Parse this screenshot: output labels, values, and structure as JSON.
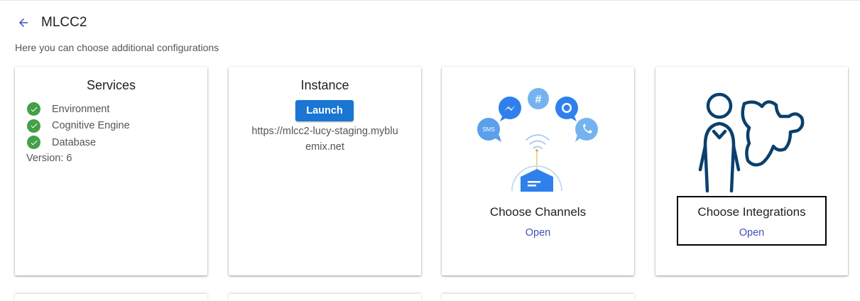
{
  "header": {
    "title": "MLCC2",
    "back_icon": "arrow-left-icon"
  },
  "subtitle": "Here you can choose additional configurations",
  "colors": {
    "accent": "#1976d2",
    "link": "#3f51b5",
    "check": "#43a047",
    "illustration": "#4a90e2",
    "navy": "#0b3f6d"
  },
  "services": {
    "title": "Services",
    "items": [
      {
        "label": "Environment",
        "status_icon": "check-circle-icon"
      },
      {
        "label": "Cognitive Engine",
        "status_icon": "check-circle-icon"
      },
      {
        "label": "Database",
        "status_icon": "check-circle-icon"
      }
    ],
    "version_label": "Version:",
    "version_value": "6"
  },
  "instance": {
    "title": "Instance",
    "launch_label": "Launch",
    "url": "https://mlcc2-lucy-staging.mybluemix.net"
  },
  "channels": {
    "label": "Choose Channels",
    "open_label": "Open",
    "bubbles": [
      {
        "icon": "sms-icon",
        "text": "SMS"
      },
      {
        "icon": "messenger-icon"
      },
      {
        "icon": "hashtag-icon",
        "text": "#"
      },
      {
        "icon": "chat-icon"
      },
      {
        "icon": "phone-icon"
      }
    ]
  },
  "integrations": {
    "label": "Choose Integrations",
    "open_label": "Open",
    "illustration_icon": "person-puzzle-icon"
  }
}
